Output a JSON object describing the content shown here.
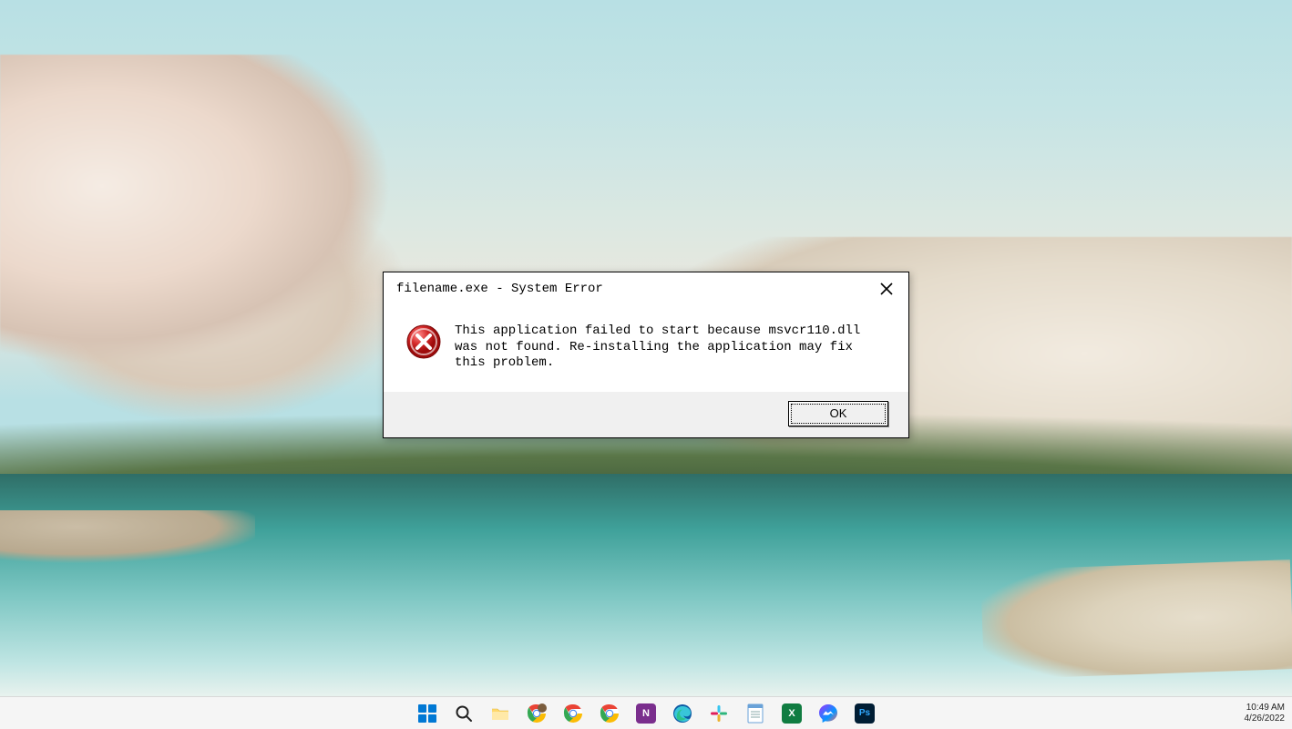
{
  "dialog": {
    "title": "filename.exe - System Error",
    "message": "This application failed to start because msvcr110.dll was not found. Re-installing the application may fix this problem.",
    "ok_label": "OK"
  },
  "taskbar": {
    "items": [
      {
        "name": "start",
        "label": "Start"
      },
      {
        "name": "search",
        "label": "Search"
      },
      {
        "name": "file-explorer",
        "label": "File Explorer"
      },
      {
        "name": "chrome-profile",
        "label": "Google Chrome (profile)"
      },
      {
        "name": "chrome-1",
        "label": "Google Chrome"
      },
      {
        "name": "chrome-2",
        "label": "Google Chrome"
      },
      {
        "name": "onenote",
        "label": "OneNote"
      },
      {
        "name": "edge",
        "label": "Microsoft Edge"
      },
      {
        "name": "slack",
        "label": "Slack"
      },
      {
        "name": "notepad",
        "label": "Notepad"
      },
      {
        "name": "excel",
        "label": "Excel"
      },
      {
        "name": "messenger",
        "label": "Messenger"
      },
      {
        "name": "photoshop",
        "label": "Photoshop"
      }
    ]
  },
  "system_tray": {
    "time": "10:49 AM",
    "date": "4/26/2022"
  }
}
